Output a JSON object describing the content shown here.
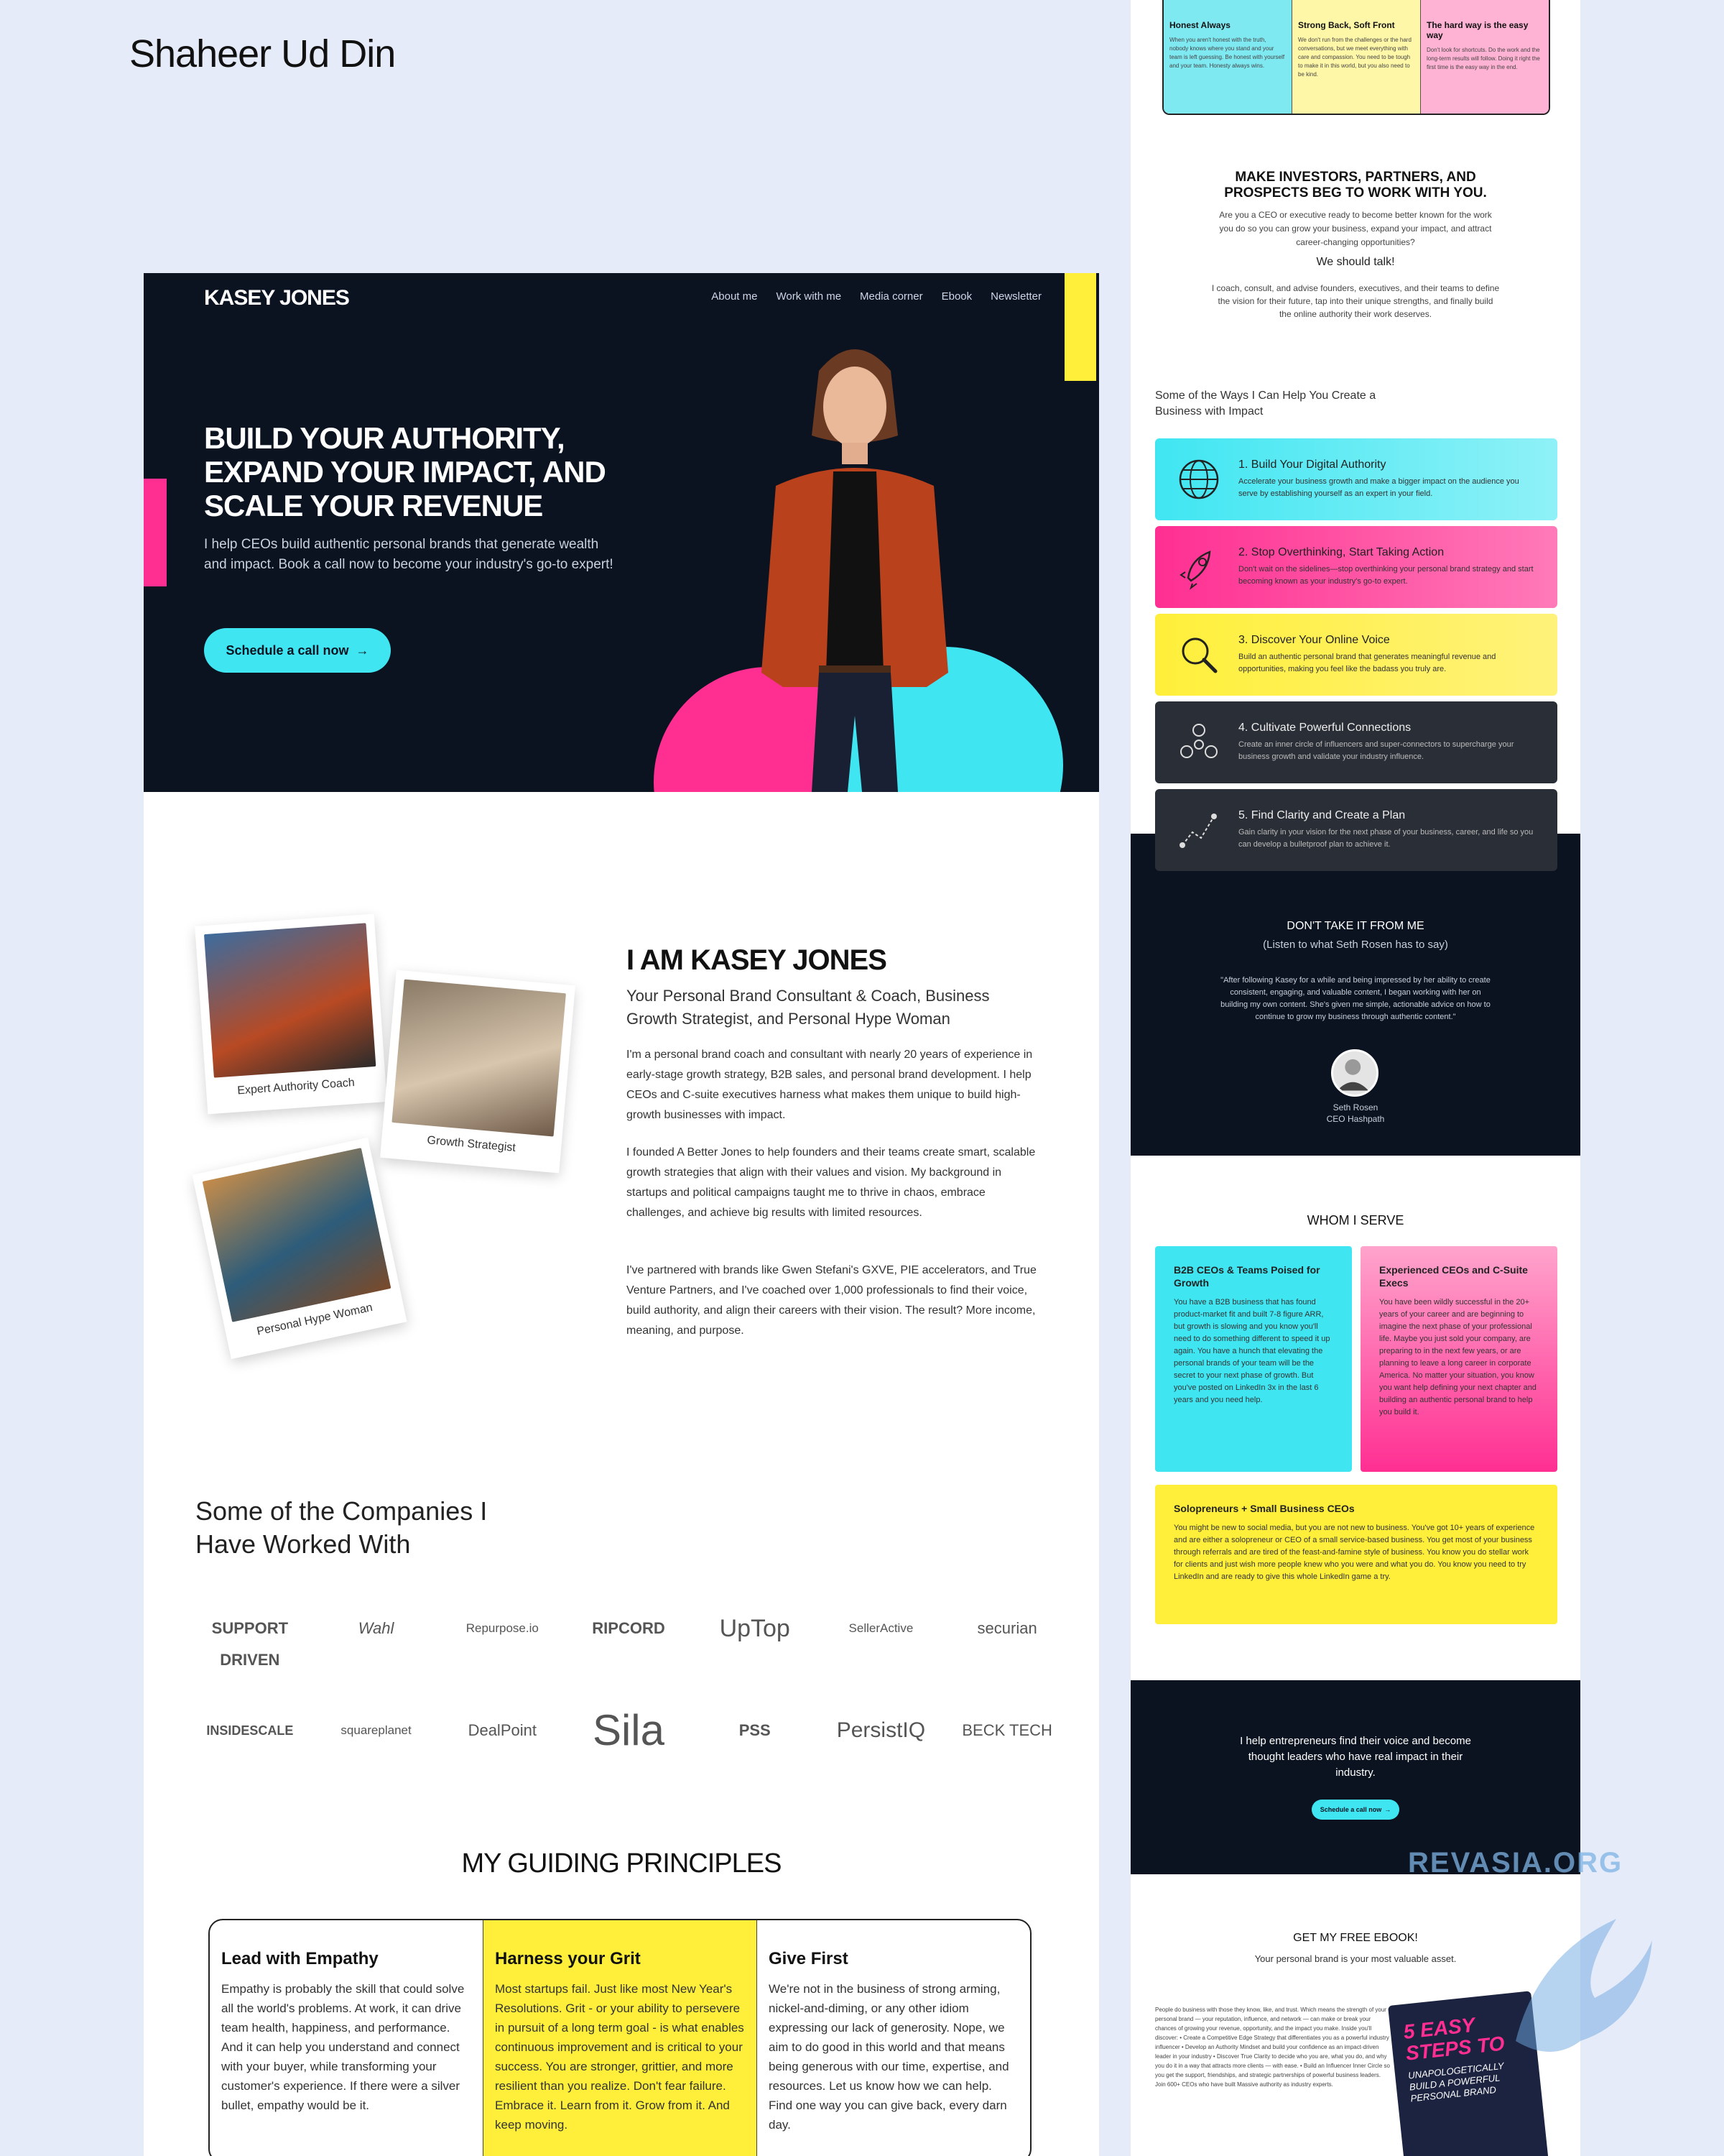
{
  "designer": "Shaheer Ud Din",
  "hero": {
    "logo": "KASEY JONES",
    "nav": [
      "About me",
      "Work with me",
      "Media corner",
      "Ebook",
      "Newsletter"
    ],
    "headline": "BUILD YOUR AUTHORITY, EXPAND YOUR IMPACT, AND SCALE YOUR REVENUE",
    "sub": "I help CEOs build authentic personal brands that generate wealth and impact. Book a call now to become your industry's go-to expert!",
    "cta": "Schedule a call now",
    "arrow": "→"
  },
  "about": {
    "cap1": "Expert Authority Coach",
    "cap2": "Growth Strategist",
    "cap3": "Personal Hype Woman",
    "heading": "I AM KASEY JONES",
    "sub": "Your Personal Brand Consultant & Coach, Business Growth Strategist, and Personal Hype Woman",
    "p1": "I'm a personal brand coach and consultant with nearly 20 years of experience in early-stage growth strategy, B2B sales, and personal brand development. I help CEOs and C-suite executives harness what makes them unique to build high-growth businesses with impact.",
    "p2": "I founded A Better Jones to help founders and their teams create smart, scalable growth strategies that align with their values and vision. My background in startups and political campaigns taught me to thrive in chaos, embrace challenges, and achieve big results with limited resources.",
    "p3": "I've partnered with brands like Gwen Stefani's GXVE, PIE accelerators, and True Venture Partners, and I've coached over 1,000 professionals to find their voice, build authority, and align their careers with their vision. The result? More income, meaning, and purpose."
  },
  "companies": {
    "title": "Some of the Companies I Have Worked With",
    "logos": [
      "SUPPORT DRIVEN",
      "Wahl",
      "Repurpose.io",
      "RIPCORD",
      "UpTop",
      "SellerActive",
      "securian",
      "INSIDESCALE",
      "squareplanet",
      "DealPoint",
      "Sila",
      "PSS",
      "PersistIQ",
      "BECK TECH"
    ]
  },
  "principles": {
    "title": "MY GUIDING PRINCIPLES",
    "cols": [
      {
        "title": "Lead with Empathy",
        "text": "Empathy is probably the skill that could solve all the world's problems. At work, it can drive team health, happiness, and performance. And it can help you understand and connect with your buyer, while transforming your customer's experience. If there were a silver bullet, empathy would be it."
      },
      {
        "title": "Harness your Grit",
        "text": "Most startups fail. Just like most New Year's Resolutions. Grit - or your ability to persevere in pursuit of a long term goal - is what enables continuous improvement and is critical to your success. You are stronger, grittier, and more resilient than you realize. Don't fear failure. Embrace it. Learn from it. Grow from it. And keep moving."
      },
      {
        "title": "Give First",
        "text": "We're not in the business of strong arming, nickel-and-diming, or any other idiom expressing our lack of generosity. Nope, we aim to do good in this world and that means being generous with our time, expertise, and resources. Let us know how we can help. Find one way you can give back, every darn day."
      }
    ]
  },
  "right": {
    "top": [
      {
        "title": "Honest Always",
        "text": "When you aren't honest with the truth, nobody knows where you stand and your team is left guessing. Be honest with yourself and your team. Honesty always wins."
      },
      {
        "title": "Strong Back, Soft Front",
        "text": "We don't run from the challenges or the hard conversations, but we meet everything with care and compassion. You need to be tough to make it in this world, but you also need to be kind."
      },
      {
        "title": "The hard way is the easy way",
        "text": "Don't look for shortcuts. Do the work and the long-term results will follow. Doing it right the first time is the easy way in the end."
      }
    ],
    "invest_title": "MAKE INVESTORS, PARTNERS, AND PROSPECTS BEG TO WORK WITH YOU.",
    "invest_sub": "Are you a CEO or executive ready to become better known for the work you do so you can grow your business, expand your impact, and attract career-changing opportunities?",
    "talk": "We should talk!",
    "coach": "I coach, consult, and advise founders, executives, and their teams to define the vision for their future, tap into their unique strengths, and finally build the online authority their work deserves.",
    "ways": "Some of the Ways I Can Help You Create a Business with Impact",
    "cards": [
      {
        "title": "1. Build Your Digital Authority",
        "text": "Accelerate your business growth and make a bigger impact on the audience you serve by establishing yourself as an expert in your field.",
        "icon": "globe-icon"
      },
      {
        "title": "2. Stop Overthinking, Start Taking Action",
        "text": "Don't wait on the sidelines—stop overthinking your personal brand strategy and start becoming known as your industry's go-to expert.",
        "icon": "rocket-icon"
      },
      {
        "title": "3. Discover Your Online Voice",
        "text": "Build an authentic personal brand that generates meaningful revenue and opportunities, making you feel like the badass you truly are.",
        "icon": "magnifier-icon"
      },
      {
        "title": "4. Cultivate Powerful Connections",
        "text": "Create an inner circle of influencers and super-connectors to supercharge your business growth and validate your industry influence.",
        "icon": "network-icon"
      },
      {
        "title": "5. Find Clarity and Create a Plan",
        "text": "Gain clarity in your vision for the next phase of your business, career, and life so you can develop a bulletproof plan to achieve it.",
        "icon": "path-icon"
      }
    ],
    "testi_title": "DON'T TAKE IT FROM ME",
    "testi_sub": "(Listen to what Seth Rosen has to say)",
    "testi_quote": "\"After following Kasey for a while and being impressed by her ability to create consistent, engaging, and valuable content, I began working with her on building my own content. She's given me simple, actionable advice on how to continue to grow my business through authentic content.\"",
    "testi_name": "Seth Rosen",
    "testi_role": "CEO Hashpath",
    "whom": "WHOM I SERVE",
    "serve": [
      {
        "title": "B2B CEOs & Teams Poised for Growth",
        "text": "You have a B2B business that has found product-market fit and built 7-8 figure ARR, but growth is slowing and you know you'll need to do something different to speed it up again. You have a hunch that elevating the personal brands of your team will be the secret to your next phase of growth. But you've posted on LinkedIn 3x in the last 6 years and you need help."
      },
      {
        "title": "Experienced CEOs and C-Suite Execs",
        "text": "You have been wildly successful in the 20+ years of your career and are beginning to imagine the next phase of your professional life. Maybe you just sold your company, are preparing to in the next few years, or are planning to leave a long career in corporate America. No matter your situation, you know you want help defining your next chapter and building an authentic personal brand to help you build it."
      },
      {
        "title": "Solopreneurs + Small Business CEOs",
        "text": "You might be new to social media, but you are not new to business. You've got 10+ years of experience and are either a solopreneur or CEO of a small service-based business. You get most of your business through referrals and are tired of the feast-and-famine style of business. You know you do stellar work for clients and just wish more people knew who you were and what you do. You know you need to try LinkedIn and are ready to give this whole LinkedIn game a try."
      }
    ],
    "help": "I help entrepreneurs find their voice and become thought leaders who have real impact in their industry.",
    "help_cta": "Schedule a call now",
    "help_arrow": "→",
    "ebook_title": "GET MY FREE EBOOK!",
    "ebook_sub": "Your personal brand is your most valuable asset.",
    "ebook_text": "People do business with those they know, like, and trust. Which means the strength of your personal brand — your reputation, influence, and network — can make or break your chances of growing your revenue, opportunity, and the impact you make. Inside you'll discover: • Create a Competitive Edge Strategy that differentiates you as a powerful industry influencer • Develop an Authority Mindset and build your confidence as an impact-driven leader in your industry • Discover True Clarity to decide who you are, what you do, and why you do it in a way that attracts more clients — with ease. • Build an Influencer Inner Circle so you get the support, friendships, and strategic partnerships of powerful business leaders. Join 600+ CEOs who have built Massive authority as industry experts.",
    "ebook_cover": [
      "5 EASY STEPS TO",
      "UNAPOLOGETICALLY BUILD A POWERFUL PERSONAL BRAND"
    ]
  },
  "watermark": "REVASIA.ORG",
  "colors": {
    "dark": "#0b1220",
    "cyan": "#3fe6f2",
    "pink": "#ff2f92",
    "yellow": "#ffef3a"
  }
}
